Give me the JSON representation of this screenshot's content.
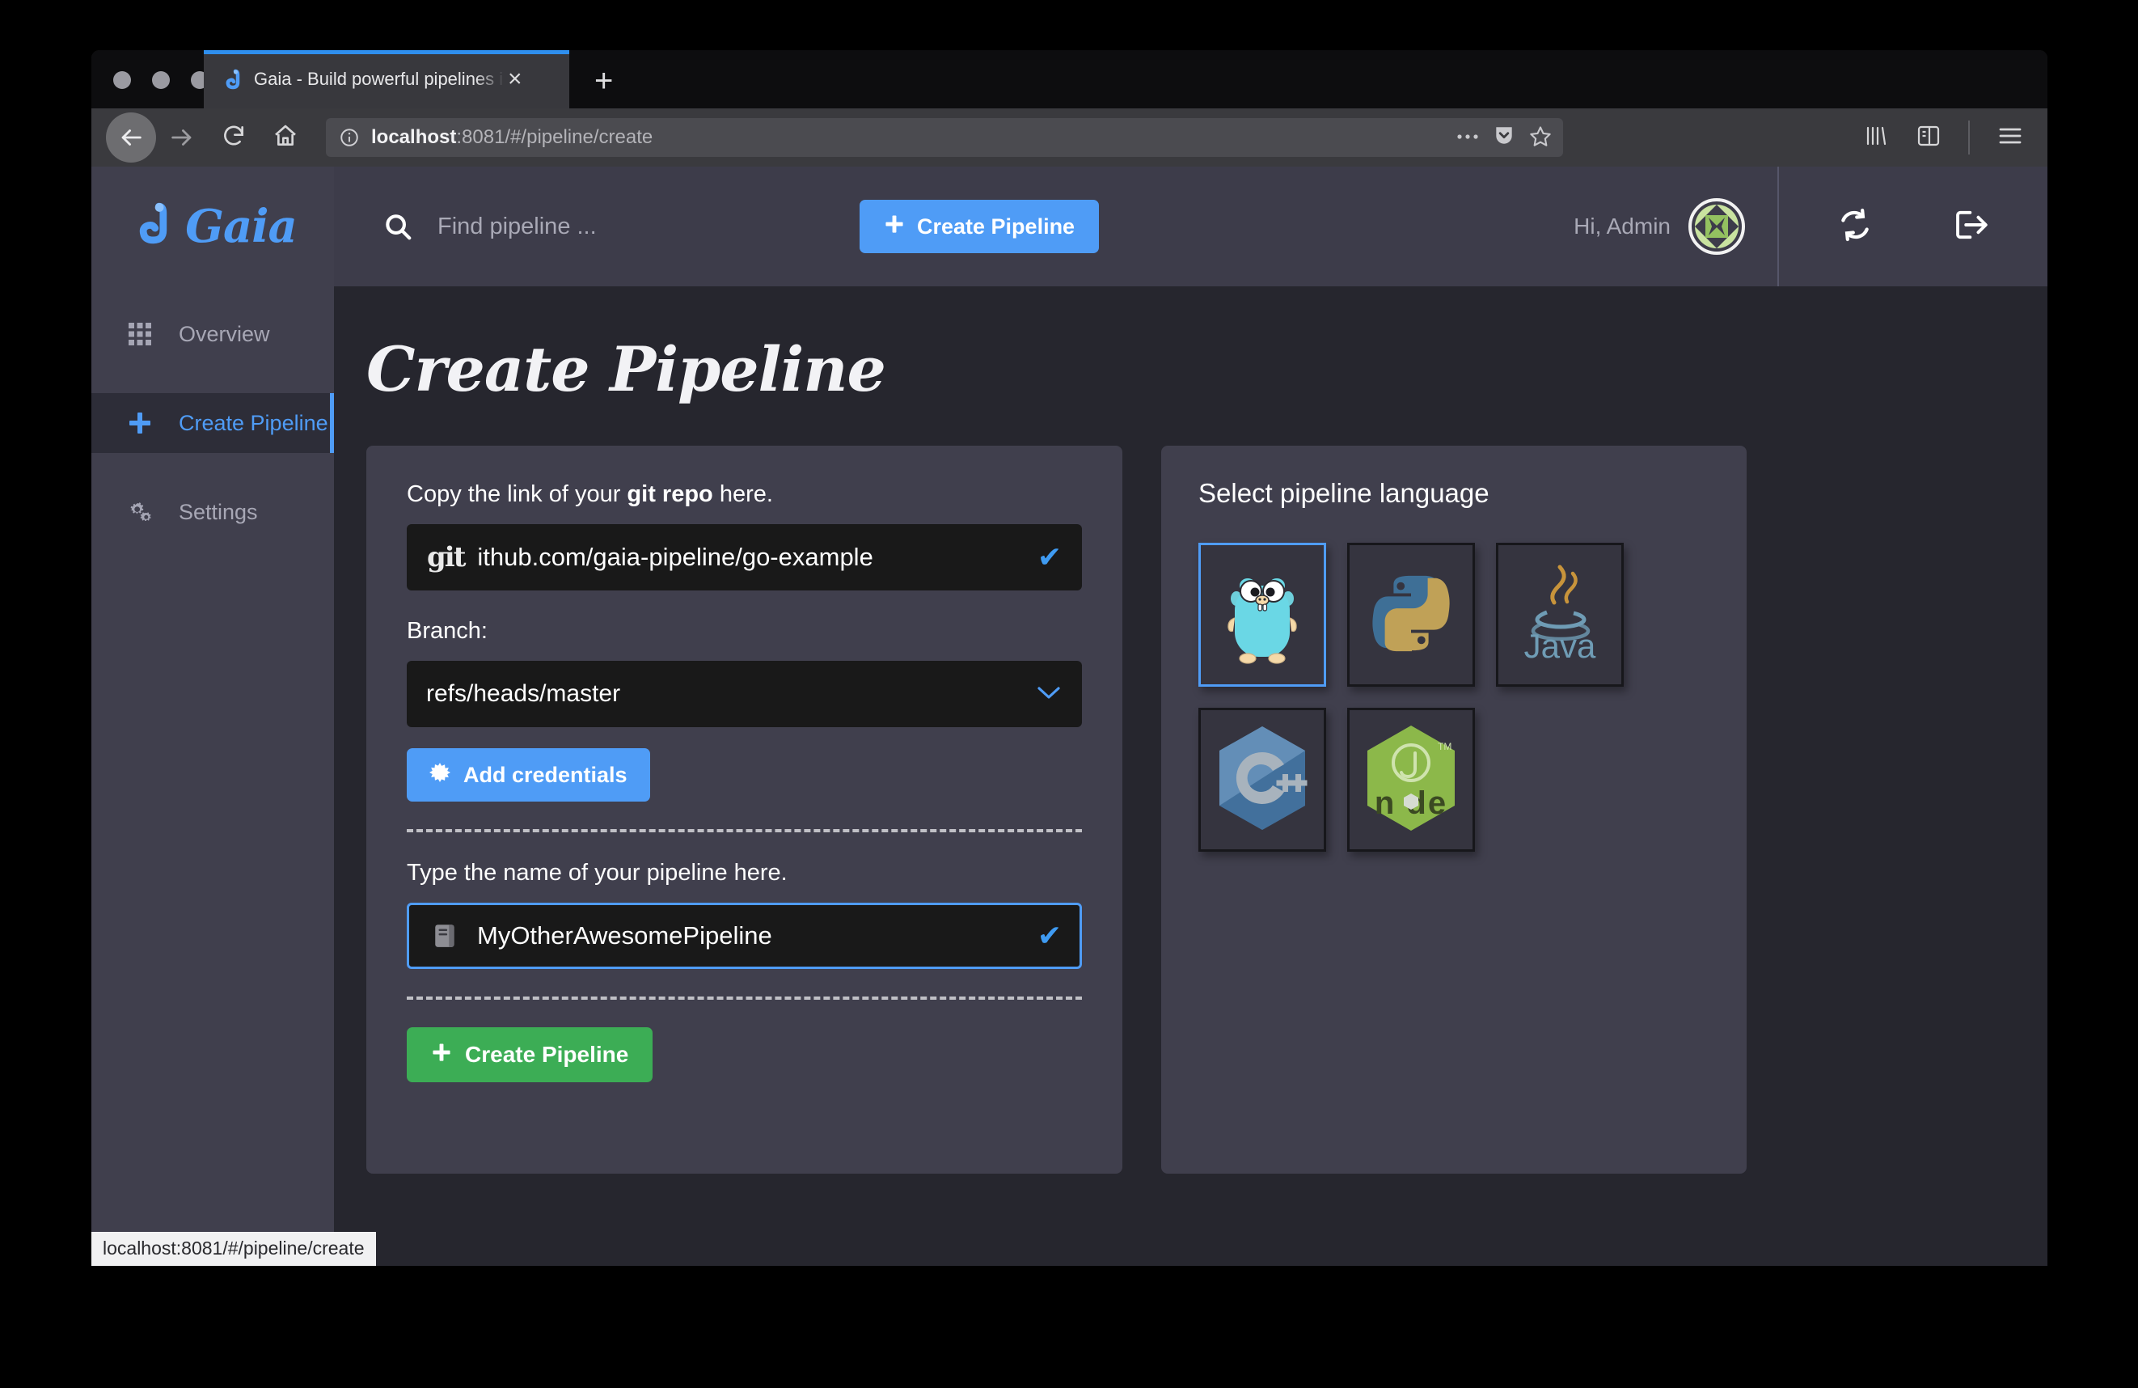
{
  "browser": {
    "tab": {
      "title": "Gaia - Build powerful pipelines i",
      "favicon": "gaia-logo-icon",
      "close_label": "×"
    },
    "new_tab_label": "+",
    "toolbar": {
      "back_icon": "back-arrow-icon",
      "forward_icon": "forward-arrow-icon",
      "reload_icon": "reload-icon",
      "home_icon": "home-icon",
      "url_info_icon": "info-circle-icon",
      "url_host": "localhost",
      "url_rest": ":8081/#/pipeline/create",
      "page_actions_icon": "ellipsis-icon",
      "pocket_icon": "pocket-shield-icon",
      "bookmark_icon": "star-icon",
      "library_icon": "library-icon",
      "sidebar_icon": "sidebar-panel-icon",
      "menu_icon": "hamburger-menu-icon"
    },
    "status_url": "localhost:8081/#/pipeline/create"
  },
  "app": {
    "logo_text": "Gaia",
    "sidebar": {
      "items": [
        {
          "label": "Overview",
          "icon": "grid-icon",
          "active": false
        },
        {
          "label": "Create Pipeline",
          "icon": "plus-icon",
          "active": true
        },
        {
          "label": "Settings",
          "icon": "gears-icon",
          "active": false
        }
      ]
    },
    "topbar": {
      "search_icon": "search-icon",
      "search_placeholder": "Find pipeline ...",
      "search_value": "",
      "create_button": "Create Pipeline",
      "create_button_icon": "plus-icon",
      "greeting": "Hi, Admin",
      "avatar_icon": "user-avatar-icon",
      "refresh_icon": "refresh-icon",
      "logout_icon": "logout-icon"
    },
    "page": {
      "title": "Create Pipeline",
      "form": {
        "repo_label_pre": "Copy the link of your ",
        "repo_label_bold": "git repo",
        "repo_label_post": " here.",
        "repo_icon": "git-logo-icon",
        "repo_value": "ithub.com/gaia-pipeline/go-example",
        "repo_valid_icon": "check-icon",
        "branch_label": "Branch:",
        "branch_value": "refs/heads/master",
        "branch_chevron_icon": "chevron-down-icon",
        "add_credentials_label": "Add credentials",
        "add_credentials_icon": "asterisk-icon",
        "name_label": "Type the name of your pipeline here.",
        "name_icon": "notebook-icon",
        "name_value": "MyOtherAwesomePipeline",
        "name_valid_icon": "check-icon",
        "create_label": "Create Pipeline",
        "create_icon": "plus-icon"
      },
      "languages": {
        "title": "Select pipeline language",
        "tiles": [
          {
            "name": "golang",
            "icon": "golang-gopher-icon",
            "selected": true
          },
          {
            "name": "python",
            "icon": "python-logo-icon",
            "selected": false
          },
          {
            "name": "java",
            "icon": "java-logo-icon",
            "selected": false
          },
          {
            "name": "cpp",
            "icon": "cplusplus-logo-icon",
            "selected": false
          },
          {
            "name": "nodejs",
            "icon": "nodejs-logo-icon",
            "selected": false
          }
        ]
      }
    }
  }
}
